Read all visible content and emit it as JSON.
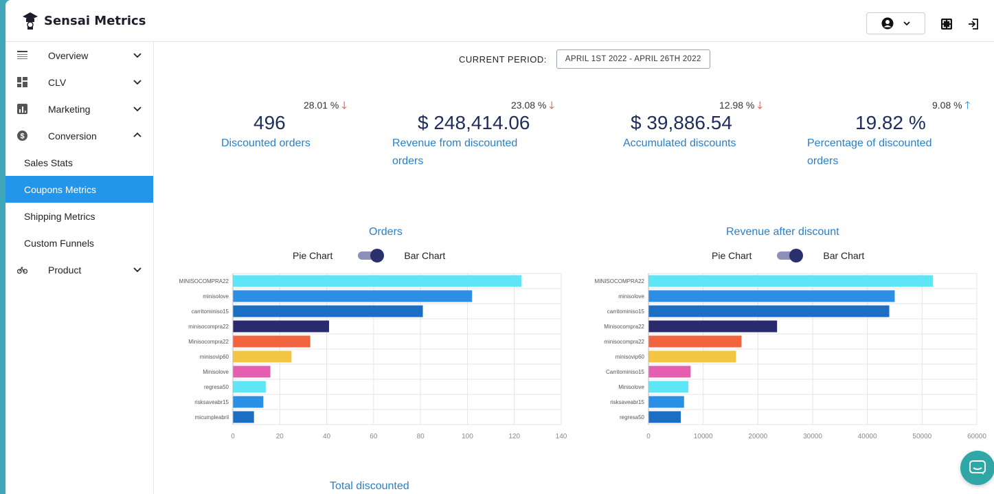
{
  "app": {
    "name": "Sensai Metrics"
  },
  "icons": {
    "logo": "graduation-cap-icon",
    "user": "user-circle-icon",
    "fullscreen": "fullscreen-icon",
    "logout": "logout-icon",
    "chat": "chat-icon"
  },
  "sidebar": {
    "items": [
      {
        "label": "Overview",
        "icon": "overview-icon"
      },
      {
        "label": "CLV",
        "icon": "dashboard-icon"
      },
      {
        "label": "Marketing",
        "icon": "bar-chart-icon"
      },
      {
        "label": "Conversion",
        "icon": "dollar-icon"
      }
    ],
    "subitems": [
      "Sales Stats",
      "Coupons Metrics",
      "Shipping Metrics",
      "Custom Funnels"
    ],
    "active_subitem": "Coupons Metrics",
    "product": {
      "label": "Product",
      "icon": "bicycle-icon"
    }
  },
  "period": {
    "label": "CURRENT PERIOD:",
    "value": "APRIL 1ST 2022 - APRIL 26TH 2022"
  },
  "kpis": [
    {
      "change": "28.01 %",
      "direction": "down",
      "value": "496",
      "label": "Discounted orders"
    },
    {
      "change": "23.08 %",
      "direction": "down",
      "value": "$ 248,414.06",
      "label": "Revenue from discounted orders"
    },
    {
      "change": "12.98 %",
      "direction": "down",
      "value": "$ 39,886.54",
      "label": "Accumulated discounts"
    },
    {
      "change": "9.08 %",
      "direction": "up",
      "value": "19.82 %",
      "label": "Percentage of discounted orders"
    }
  ],
  "toggle": {
    "left": "Pie Chart",
    "right": "Bar Chart"
  },
  "colors": {
    "accent": "#2396ec",
    "down": "#e53935",
    "up": "#1e88e5",
    "bars": [
      "#5ee6f7",
      "#2b8fe6",
      "#1a6fc4",
      "#2a2a6e",
      "#f2633f",
      "#f4c542",
      "#e45fb0",
      "#5ee6f7",
      "#2b8fe6",
      "#1a6fc4"
    ]
  },
  "chart_data": [
    {
      "type": "bar",
      "orientation": "horizontal",
      "title": "Orders",
      "categories": [
        "MINISOCOMPRA22",
        "minisolove",
        "carritominiso15",
        "minisocompra22",
        "Minisocompra22",
        "minisovip60",
        "Minisolove",
        "regresa50",
        "risksaveabr15",
        "micumpleabril"
      ],
      "values": [
        123,
        102,
        81,
        41,
        33,
        25,
        16,
        14,
        13,
        9
      ],
      "xlim": [
        0,
        140
      ],
      "xticks": [
        0,
        20,
        40,
        60,
        80,
        100,
        120,
        140
      ],
      "grid": true
    },
    {
      "type": "bar",
      "orientation": "horizontal",
      "title": "Revenue after discount",
      "categories": [
        "MINISOCOMPRA22",
        "minisolove",
        "carritominiso15",
        "Minisocompra22",
        "minisocompra22",
        "minisovip60",
        "Carritominiso15",
        "Minisolove",
        "risksaveabr15",
        "regresa50"
      ],
      "values": [
        52000,
        45000,
        44000,
        23500,
        17000,
        16000,
        7700,
        7300,
        6500,
        5900
      ],
      "xlim": [
        0,
        60000
      ],
      "xticks": [
        0,
        10000,
        20000,
        30000,
        40000,
        50000,
        60000
      ],
      "grid": true
    }
  ],
  "total_section": {
    "title": "Total discounted"
  }
}
